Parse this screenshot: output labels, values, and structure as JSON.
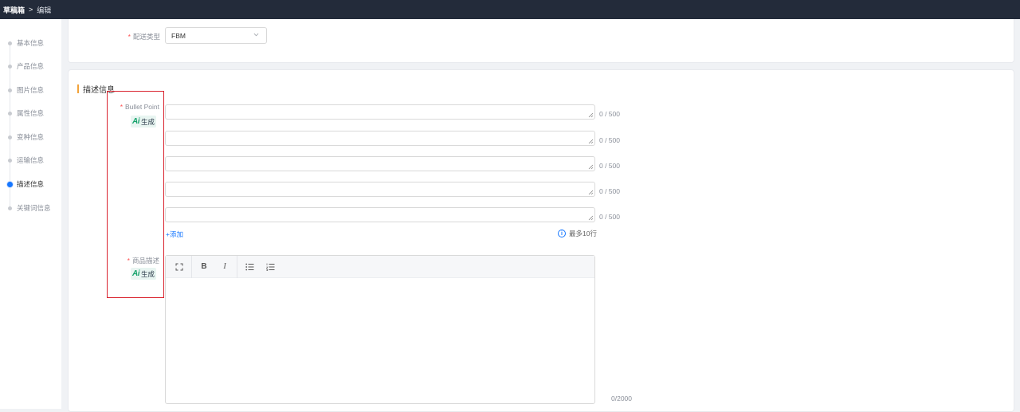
{
  "breadcrumb": {
    "root": "草稿箱",
    "separator": ">",
    "current": "编辑"
  },
  "sidebar": {
    "items": [
      {
        "label": "基本信息",
        "active": false
      },
      {
        "label": "产品信息",
        "active": false
      },
      {
        "label": "图片信息",
        "active": false
      },
      {
        "label": "属性信息",
        "active": false
      },
      {
        "label": "变种信息",
        "active": false
      },
      {
        "label": "运输信息",
        "active": false
      },
      {
        "label": "描述信息",
        "active": true
      },
      {
        "label": "关键词信息",
        "active": false
      }
    ]
  },
  "shipping": {
    "label": "配送类型",
    "value": "FBM"
  },
  "description": {
    "section_title": "描述信息",
    "bullet": {
      "label": "Bullet Point",
      "ai_mark": "Ai",
      "ai_label": "生成",
      "fields": [
        {
          "value": "",
          "count": "0 / 500"
        },
        {
          "value": "",
          "count": "0 / 500"
        },
        {
          "value": "",
          "count": "0 / 500"
        },
        {
          "value": "",
          "count": "0 / 500"
        },
        {
          "value": "",
          "count": "0 / 500"
        }
      ],
      "add_label": "+添加",
      "hint": "最多10行",
      "hint_icon": "i"
    },
    "product_desc": {
      "label": "商品描述",
      "ai_mark": "Ai",
      "ai_label": "生成",
      "toolbar": {
        "bold": "B",
        "italic": "I"
      },
      "count": "0/2000"
    }
  },
  "colors": {
    "accent": "#1677ff",
    "header": "#232b3a",
    "section_bar": "#f2a33a",
    "highlight_box": "#d9232e",
    "ai_green": "#15a36b"
  }
}
